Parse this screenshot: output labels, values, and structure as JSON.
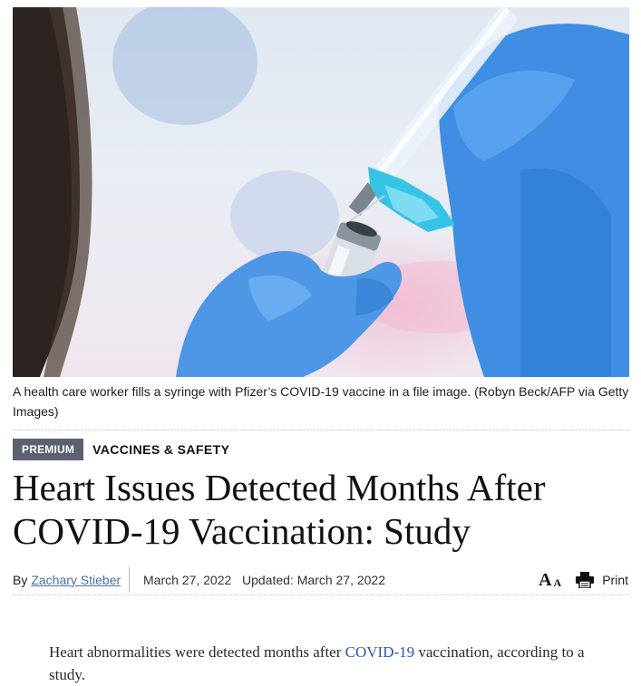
{
  "hero": {
    "caption": "A health care worker fills a syringe with Pfizer’s COVID-19 vaccine in a file image. (Robyn Beck/AFP via Getty Images)"
  },
  "tags": {
    "premium": "PREMIUM",
    "section": "VACCINES & SAFETY"
  },
  "article": {
    "title_line1": "Heart Issues Detected Months After",
    "title_line2": "COVID-19 Vaccination: Study",
    "by": "By",
    "author": "Zachary Stieber",
    "date": "March 27, 2022",
    "updated": "Updated: March 27, 2022",
    "lede_before": "Heart abnormalities were detected months after",
    "lede_link": "COVID-19",
    "lede_after": "vaccination, according to a study."
  },
  "tools": {
    "font_big": "A",
    "font_small": "A",
    "print_label": "Print"
  }
}
